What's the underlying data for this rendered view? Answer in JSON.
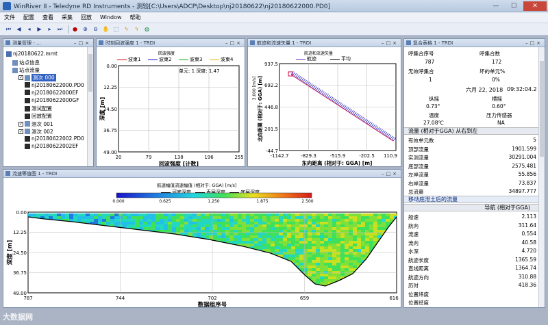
{
  "window": {
    "title": "WinRiver II - Teledyne RD Instruments - 测验[C:\\Users\\ADCP\\Desktop\\nj20180622\\nj20180622000.PD0]"
  },
  "menu": [
    "文件",
    "配置",
    "查看",
    "采集",
    "回放",
    "Window",
    "帮助"
  ],
  "toolbar": [
    "skip-start-icon",
    "step-back-icon",
    "play-back-icon",
    "play-icon",
    "step-forward-icon",
    "skip-end-icon",
    "separator",
    "record-icon",
    "zoom-in-icon",
    "zoom-out-icon",
    "pan-icon",
    "select-icon",
    "lightning-icon",
    "lightning-icon",
    "globe-icon"
  ],
  "tree": {
    "title": "测量管理 - ...",
    "root": "nj20180622.mmt",
    "items": [
      {
        "label": "站点信息",
        "indent": 1
      },
      {
        "label": "站点流量",
        "indent": 1
      },
      {
        "label": "测次 000",
        "indent": 2,
        "checked": true,
        "selected": true
      },
      {
        "label": "nj20180622000.PD0",
        "indent": 3
      },
      {
        "label": "nj20180622000EF",
        "indent": 3
      },
      {
        "label": "nj20180622000GF",
        "indent": 3
      },
      {
        "label": "测试配置",
        "indent": 3
      },
      {
        "label": "回放配置",
        "indent": 3
      },
      {
        "label": "测次 001",
        "indent": 2,
        "checked": true
      },
      {
        "label": "测次 002",
        "indent": 2,
        "checked": true
      },
      {
        "label": "nj20180622002.PD0",
        "indent": 3
      },
      {
        "label": "nj20180622002EF",
        "indent": 3
      }
    ]
  },
  "intensity": {
    "title": "时刻回波强度 1 - TRDI",
    "legend": [
      "波束1",
      "波束2",
      "波束3",
      "波束4"
    ],
    "colors": [
      "#cc0000",
      "#0000cc",
      "#00aa00",
      "#e0b000"
    ],
    "subtitle": "回波强度",
    "readout": "单元: 1   深度: 1.47",
    "ylabel": "深度 [m]",
    "xlabel": "回波强度 [计数]",
    "yticks": [
      "0.00",
      "12.25",
      "24.50",
      "36.75",
      "49.00"
    ],
    "xticks": [
      "20",
      "79",
      "138",
      "196",
      "255"
    ]
  },
  "track": {
    "title": "航迹和流速矢量 1 - TRDI",
    "subtitle": "航迹和流速矢量",
    "legend": [
      "航迹",
      "平均"
    ],
    "colors": [
      "#6a2cc0",
      "#000000"
    ],
    "ylabel": "北向距离 (相对于: GGA) [m]",
    "ylabel2": "3.000 [m/s]",
    "xlabel": "东向距离 (相对于: GGA) [m]",
    "yticks": [
      "937.5",
      "692.2",
      "446.8",
      "201.5",
      "-44.7"
    ],
    "xticks": [
      "-1142.7",
      "-829.3",
      "-515.9",
      "-202.5",
      "110.9"
    ]
  },
  "summary": {
    "title": "复合表格 1 - TRDI",
    "hdr1": [
      "呼集合序号",
      "呼集合数"
    ],
    "val1": [
      "787",
      "172"
    ],
    "hdr2": [
      "无效呼集合",
      "坏的单元%"
    ],
    "val2": [
      "1",
      "0%"
    ],
    "date": "六月 22, 2018",
    "time": "09:32:04.2",
    "hdr3": [
      "纵摇",
      "横摇"
    ],
    "val3": [
      "0.73°",
      "0.60°"
    ],
    "hdr4": [
      "温度",
      "压力传感器"
    ],
    "val4": [
      "27.08℃",
      "NA"
    ],
    "flow_title": "流量 (相对于GGA) 从右到左",
    "flow": [
      {
        "k": "有效单元数",
        "v": "5"
      },
      {
        "k": "顶部流量",
        "v": "1901.599"
      },
      {
        "k": "实测流量",
        "v": "30291.004"
      },
      {
        "k": "底部流量",
        "v": "2575.481"
      },
      {
        "k": "左岸流量",
        "v": "55.856"
      },
      {
        "k": "右岸流量",
        "v": "73.837"
      },
      {
        "k": "总流量",
        "v": "34897.777"
      }
    ],
    "bottom_note": "移动底泄土后的流量",
    "nav_title": "导航 (相对于GGA)",
    "nav": [
      {
        "k": "船速",
        "v": "2.113"
      },
      {
        "k": "航向",
        "v": "311.64"
      },
      {
        "k": "流速",
        "v": "0.554"
      },
      {
        "k": "流向",
        "v": "40.58"
      },
      {
        "k": "水深",
        "v": "4.720"
      },
      {
        "k": "航迹长度",
        "v": "1365.59"
      },
      {
        "k": "直线距离",
        "v": "1364.74"
      },
      {
        "k": "航迹方向",
        "v": "310.88"
      },
      {
        "k": "历时",
        "v": "418.36"
      },
      {
        "k": "位置纬度",
        "v": ""
      },
      {
        "k": "位置经度",
        "v": ""
      }
    ]
  },
  "contour": {
    "title": "流速等值图 1 - TRDI",
    "subtitle": "航速幅值流速幅值 (相对于: GGA) [m/s]",
    "colorbar": [
      "0.000",
      "0.625",
      "1.250",
      "1.875",
      "2.500"
    ],
    "legend": [
      "河底深度",
      "表层深度",
      "底层深度"
    ],
    "ylabel": "深度 [m]",
    "xlabel": "数据组序号",
    "yticks": [
      "0.00",
      "12.25",
      "24.50",
      "36.75",
      "49.00"
    ],
    "xticks": [
      "787",
      "744",
      "702",
      "659",
      "616"
    ]
  },
  "watermark": "大数据网"
}
